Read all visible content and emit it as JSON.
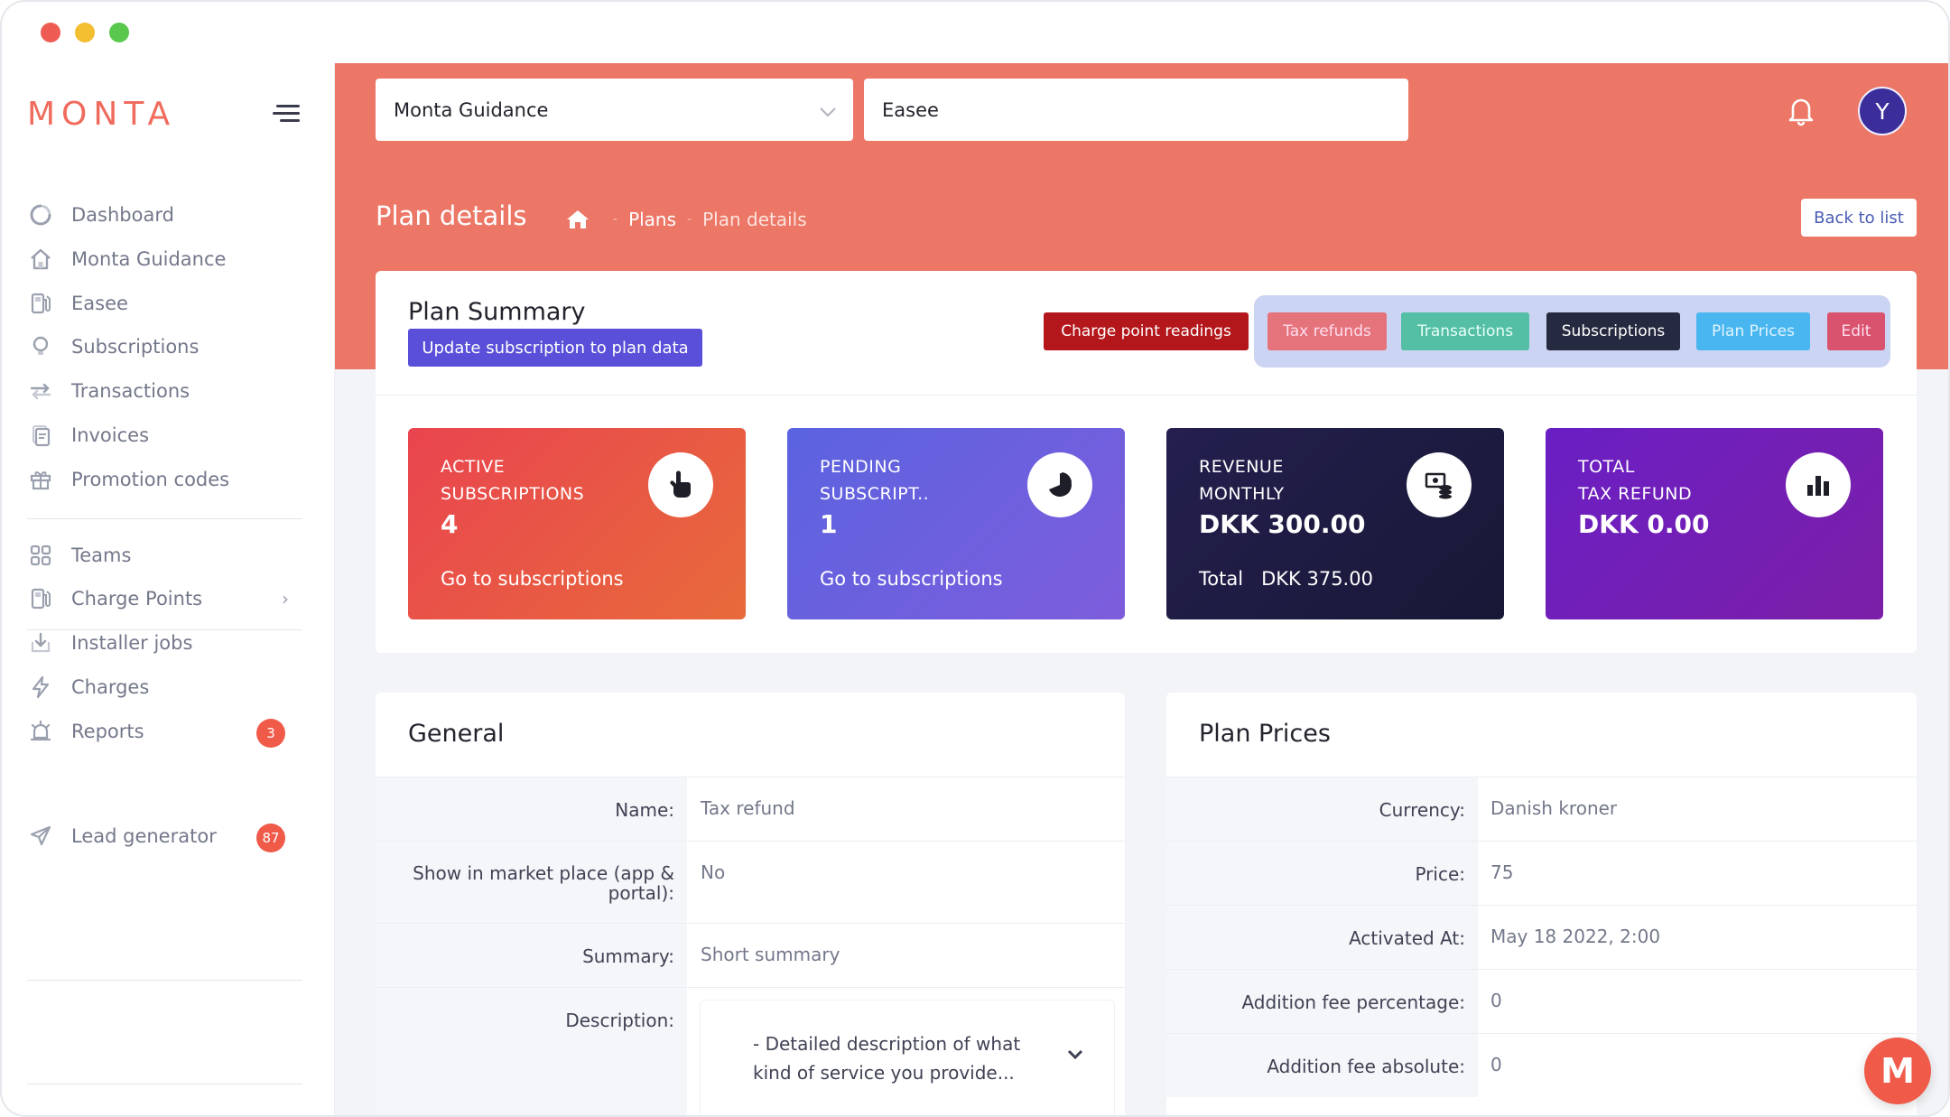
{
  "brand": {
    "logo": "MONTA"
  },
  "sidebar": {
    "items": [
      {
        "label": "Dashboard",
        "icon": "dashboard-icon"
      },
      {
        "label": "Monta Guidance",
        "icon": "home-icon"
      },
      {
        "label": "Easee",
        "icon": "fuel-pump-icon"
      },
      {
        "label": "Subscriptions",
        "icon": "lightbulb-icon"
      },
      {
        "label": "Transactions",
        "icon": "arrows-icon"
      },
      {
        "label": "Invoices",
        "icon": "invoice-icon"
      },
      {
        "label": "Promotion codes",
        "icon": "gift-icon"
      }
    ],
    "items2": [
      {
        "label": "Teams",
        "icon": "grid-icon"
      },
      {
        "label": "Charge Points",
        "icon": "fuel-pump-icon"
      },
      {
        "label": "Installer jobs",
        "icon": "download-icon"
      },
      {
        "label": "Charges",
        "icon": "bolt-icon"
      },
      {
        "label": "Reports",
        "icon": "alarm-icon",
        "badge": "3"
      }
    ],
    "items3": [
      {
        "label": "Lead generator",
        "icon": "send-icon",
        "badge": "87"
      }
    ]
  },
  "topbar": {
    "operator_select": "Monta Guidance",
    "team_select": "Easee",
    "avatar_initial": "Y"
  },
  "page": {
    "title": "Plan details",
    "breadcrumb": [
      "Plans",
      "Plan details"
    ],
    "back_button": "Back to list"
  },
  "summary": {
    "title": "Plan Summary",
    "update_button": "Update subscription to plan data",
    "actions": [
      {
        "label": "Charge point readings",
        "color": "#b3171b"
      },
      {
        "label": "Tax refunds",
        "color": "#e5737b"
      },
      {
        "label": "Transactions",
        "color": "#55bfa5"
      },
      {
        "label": "Subscriptions",
        "color": "#262a40"
      },
      {
        "label": "Plan Prices",
        "color": "#49b6ef"
      },
      {
        "label": "Edit",
        "color": "#d9536f"
      }
    ],
    "stats": [
      {
        "line1": "ACTIVE",
        "line2": "SUBSCRIPTIONS",
        "value": "4",
        "footer": "Go to subscriptions",
        "icon": "hand-pointer-icon"
      },
      {
        "line1": "PENDING",
        "line2": "SUBSCRIPT..",
        "value": "1",
        "footer": "Go to subscriptions",
        "icon": "pie-chart-icon"
      },
      {
        "line1": "REVENUE",
        "line2": "MONTHLY",
        "value": "DKK 300.00",
        "footer_label": "Total",
        "footer_value": "DKK 375.00",
        "icon": "money-icon"
      },
      {
        "line1": "TOTAL",
        "line2": "TAX REFUND",
        "value": "DKK 0.00",
        "icon": "bar-chart-icon"
      }
    ]
  },
  "general": {
    "title": "General",
    "rows": [
      {
        "label": "Name:",
        "value": "Tax refund"
      },
      {
        "label": "Show in market place (app & portal):",
        "value": "No"
      },
      {
        "label": "Summary:",
        "value": "Short summary"
      },
      {
        "label": "Description:",
        "value": "- Detailed description of what kind of service you provide..."
      }
    ]
  },
  "plan_prices": {
    "title": "Plan Prices",
    "rows": [
      {
        "label": "Currency:",
        "value": "Danish kroner"
      },
      {
        "label": "Price:",
        "value": "75"
      },
      {
        "label": "Activated At:",
        "value": "May 18 2022, 2:00"
      },
      {
        "label": "Addition fee percentage:",
        "value": "0"
      },
      {
        "label": "Addition fee absolute:",
        "value": "0"
      }
    ]
  },
  "chat_button": "M"
}
